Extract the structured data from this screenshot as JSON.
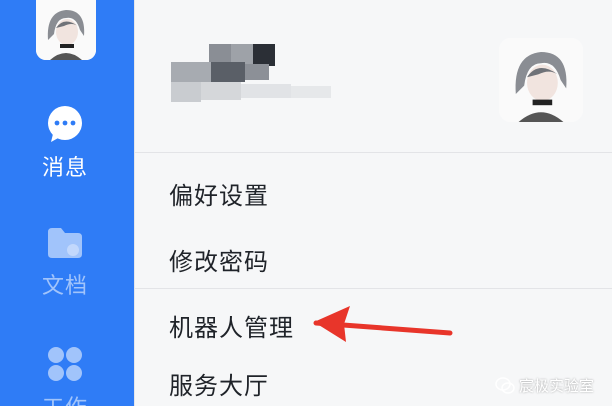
{
  "sidebar": {
    "items": [
      {
        "label": "消息",
        "icon": "chat-bubble-icon",
        "active": true
      },
      {
        "label": "文档",
        "icon": "folder-icon",
        "active": false
      },
      {
        "label": "工作",
        "icon": "grid-icon",
        "active": false
      }
    ]
  },
  "profile": {
    "avatar": "user-avatar"
  },
  "menu": {
    "items": [
      {
        "label": "偏好设置"
      },
      {
        "label": "修改密码"
      },
      {
        "label": "机器人管理"
      },
      {
        "label": "服务大厅"
      }
    ]
  },
  "watermark": {
    "text": "宸极实验室",
    "icon": "wechat-icon"
  },
  "colors": {
    "sidebar": "#2f7cf6",
    "panel": "#f6f7f8",
    "arrow": "#e8352a",
    "text": "#1f2329"
  }
}
